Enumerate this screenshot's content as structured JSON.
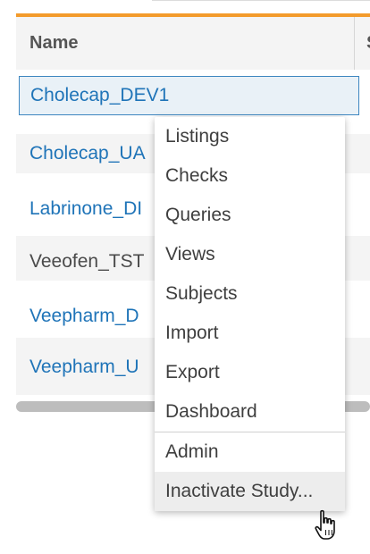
{
  "colors": {
    "accent": "#f39b2c",
    "link": "#1f74b8",
    "selected_border": "#3d86c0"
  },
  "table": {
    "columns": [
      "Name",
      "S"
    ],
    "rows": [
      {
        "name": "Cholecap_DEV1",
        "is_link": true,
        "selected": true
      },
      {
        "name": "Cholecap_UA",
        "is_link": true,
        "selected": false
      },
      {
        "name": "Labrinone_DI",
        "is_link": true,
        "selected": false
      },
      {
        "name": "Veeofen_TST",
        "is_link": false,
        "selected": false
      },
      {
        "name": "Veepharm_D",
        "is_link": true,
        "selected": false
      },
      {
        "name": "Veepharm_U",
        "is_link": true,
        "selected": false
      }
    ]
  },
  "context_menu": {
    "items": [
      "Listings",
      "Checks",
      "Queries",
      "Views",
      "Subjects",
      "Import",
      "Export",
      "Dashboard"
    ],
    "admin_items": [
      "Admin",
      "Inactivate Study..."
    ],
    "hovered_item": "Inactivate Study..."
  },
  "cursor": {
    "icon": "hand-pointer-icon"
  }
}
